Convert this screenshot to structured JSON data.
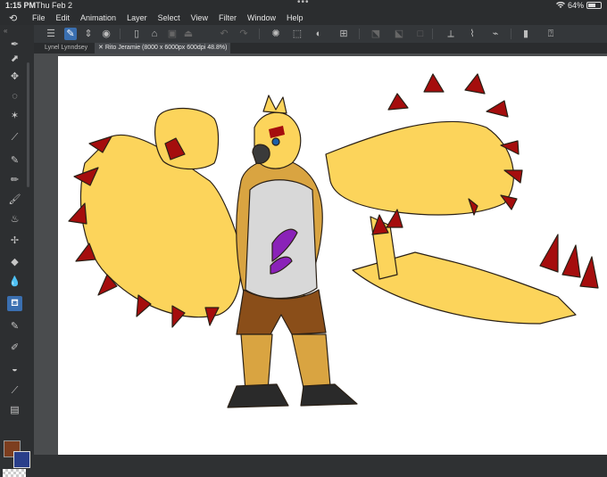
{
  "status": {
    "time": "1:15 PM",
    "date": "Thu Feb 2",
    "battery_percent": "64%",
    "battery_level": 0.64
  },
  "menu": {
    "items": [
      "File",
      "Edit",
      "Animation",
      "Layer",
      "Select",
      "View",
      "Filter",
      "Window",
      "Help"
    ]
  },
  "tabs": [
    {
      "label": "Lynel Lynndsey",
      "active": false
    },
    {
      "label": "Rito Jeramie (8000 x 6000px 600dpi 48.8%)",
      "active": true
    }
  ],
  "tools": [
    "pen-tool-icon",
    "select-layer-icon",
    "move-icon",
    "lasso-icon",
    "auto-select-icon",
    "eyedropper-icon",
    "pen-icon",
    "pencil-icon",
    "brush-icon",
    "airbrush-icon",
    "decoration-icon",
    "eraser-icon",
    "blend-icon",
    "fill-icon",
    "gradient-icon",
    "figure-icon",
    "ruler-icon",
    "text-icon",
    "balloon-icon",
    "correct-line-icon"
  ],
  "colors": {
    "main": "#7d3e1f",
    "sub": "#2a3f8a",
    "accent": "#3a6fb0"
  }
}
